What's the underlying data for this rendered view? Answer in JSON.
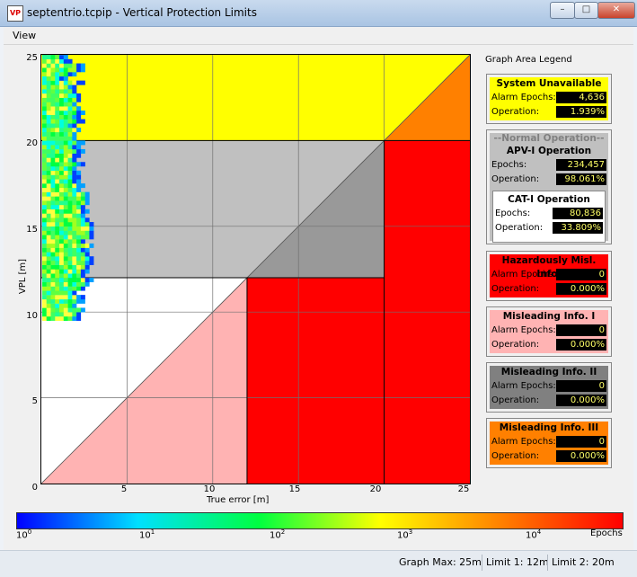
{
  "window": {
    "title": "septentrio.tcpip - Vertical Protection Limits",
    "icon_text": "VP",
    "min_symbol": "–",
    "max_symbol": "□",
    "close_symbol": "✕"
  },
  "menu": {
    "items": [
      {
        "label": "View"
      }
    ]
  },
  "plot": {
    "ylabel": "VPL [m]",
    "xlabel": "True error [m]",
    "yticks": [
      "25",
      "20",
      "15",
      "10",
      "5",
      "0"
    ],
    "xticks": [
      "5",
      "10",
      "15",
      "20",
      "25"
    ],
    "xlim": [
      0,
      25
    ],
    "ylim": [
      0,
      25
    ],
    "graph_max": 25,
    "limit1": 12,
    "limit2": 20,
    "region_colors": {
      "unavailable": "#ffff00",
      "normal_apv": "#c0c0c0",
      "normal_apv_dark": "#999999",
      "cat1": "#ffffff",
      "hmi": "#ff0000",
      "mi1": "#ffb3b3",
      "mi3": "#ff8000"
    }
  },
  "legend": {
    "title": "Graph Area Legend",
    "system_unavailable": {
      "title": "System Unavailable",
      "alarm_label": "Alarm Epochs:",
      "alarm_value": "4,636",
      "op_label": "Operation:",
      "op_value": "1.939%"
    },
    "normal": {
      "header": "--Normal Operation--",
      "title": "APV-I Operation",
      "epochs_label": "Epochs:",
      "epochs_value": "234,457",
      "op_label": "Operation:",
      "op_value": "98.061%"
    },
    "cat1": {
      "title": "CAT-I Operation",
      "epochs_label": "Epochs:",
      "epochs_value": "80,836",
      "op_label": "Operation:",
      "op_value": "33.809%"
    },
    "hmi": {
      "title": "Hazardously Misl. Info.",
      "alarm_label": "Alarm Epochs:",
      "alarm_value": "0",
      "op_label": "Operation:",
      "op_value": "0.000%"
    },
    "mi1": {
      "title": "Misleading Info. I",
      "alarm_label": "Alarm Epochs:",
      "alarm_value": "0",
      "op_label": "Operation:",
      "op_value": "0.000%"
    },
    "mi2": {
      "title": "Misleading Info. II",
      "alarm_label": "Alarm Epochs:",
      "alarm_value": "0",
      "op_label": "Operation:",
      "op_value": "0.000%"
    },
    "mi3": {
      "title": "Misleading Info. III",
      "alarm_label": "Alarm Epochs:",
      "alarm_value": "0",
      "op_label": "Operation:",
      "op_value": "0.000%"
    }
  },
  "colorbar": {
    "ticks": [
      {
        "base": "10",
        "exp": "0"
      },
      {
        "base": "10",
        "exp": "1"
      },
      {
        "base": "10",
        "exp": "2"
      },
      {
        "base": "10",
        "exp": "3"
      },
      {
        "base": "10",
        "exp": "4"
      }
    ],
    "unit": "Epochs",
    "colors": [
      "#0000ff",
      "#00e0ff",
      "#00ff40",
      "#ffff00",
      "#ff8000",
      "#ff0000"
    ]
  },
  "status": {
    "graph_max": "Graph Max: 25m",
    "limit1": "Limit 1: 12m",
    "limit2": "Limit 2: 20m"
  }
}
